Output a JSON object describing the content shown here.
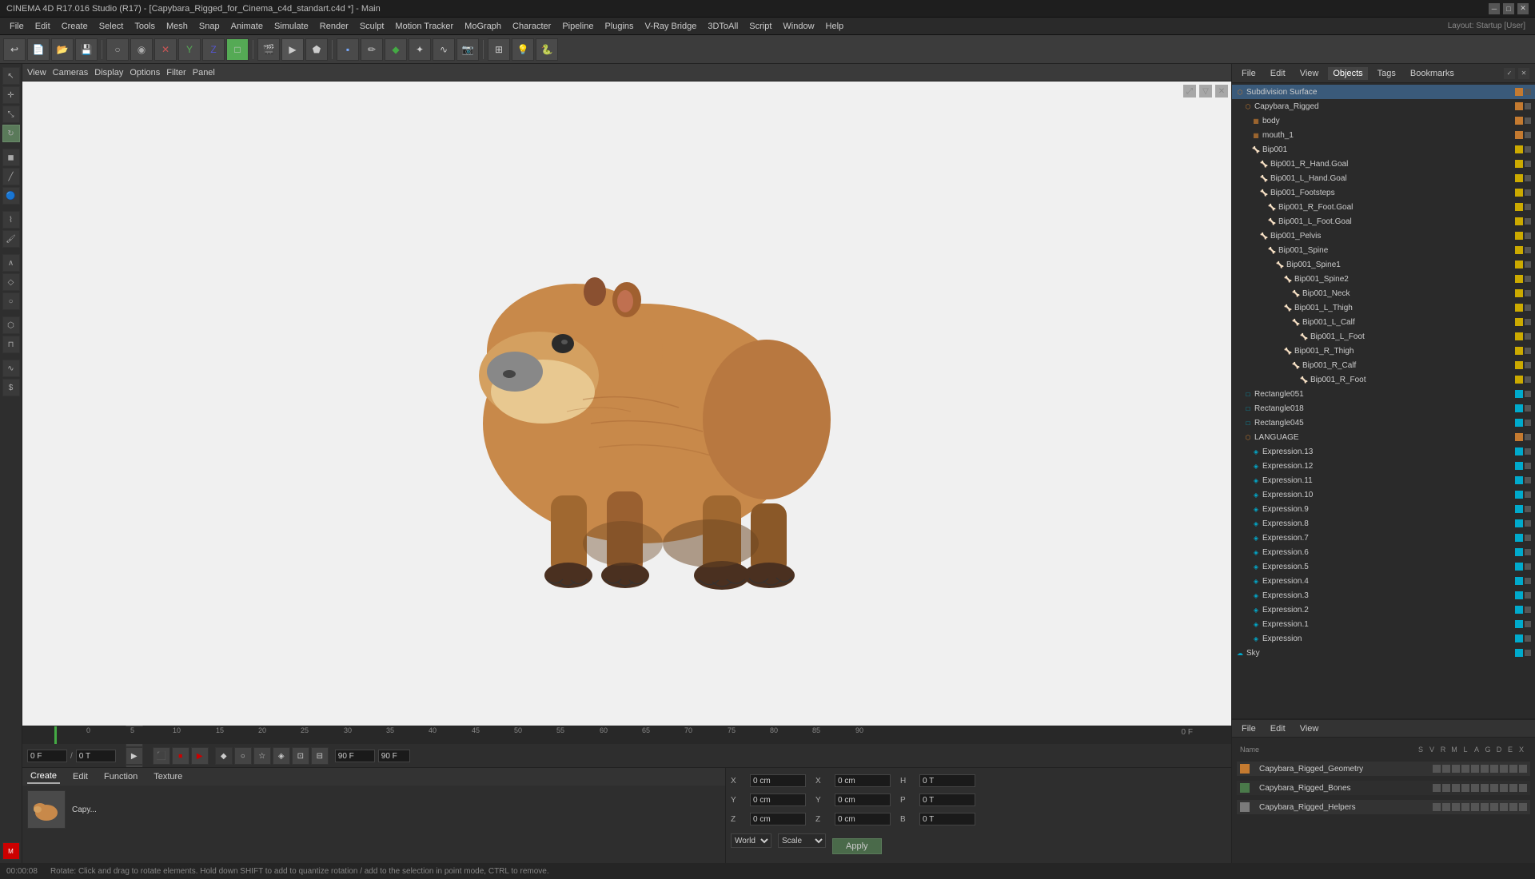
{
  "titlebar": {
    "title": "CINEMA 4D R17.016 Studio (R17) - [Capybara_Rigged_for_Cinema_c4d_standart.c4d *] - Main",
    "minimize": "─",
    "maximize": "□",
    "close": "✕"
  },
  "menus": {
    "items": [
      "File",
      "Edit",
      "Create",
      "Select",
      "Tools",
      "Mesh",
      "Snap",
      "Animate",
      "Simulate",
      "Render",
      "Sculpt",
      "Motion Tracker",
      "MoGraph",
      "Character",
      "Pipeline",
      "Plugins",
      "V-Ray Bridge",
      "3DToAll",
      "Script",
      "Window",
      "Help"
    ]
  },
  "layout": {
    "label": "Layout:",
    "value": "Startup [User]"
  },
  "viewport": {
    "tabs": [
      "View",
      "Cameras",
      "Display",
      "Options",
      "Filter",
      "Panel"
    ]
  },
  "objects": {
    "panel_tabs": [
      "File",
      "Edit",
      "View",
      "Objects",
      "Tags",
      "Bookmarks"
    ],
    "tree": [
      {
        "name": "Subdivision Surface",
        "indent": 0,
        "type": "group",
        "color": "orange",
        "expanded": true
      },
      {
        "name": "Capybara_Rigged",
        "indent": 1,
        "type": "group",
        "color": "orange",
        "expanded": true
      },
      {
        "name": "body",
        "indent": 2,
        "type": "mesh",
        "color": "orange",
        "expanded": false
      },
      {
        "name": "mouth_1",
        "indent": 2,
        "type": "mesh",
        "color": "orange",
        "expanded": false
      },
      {
        "name": "Bip001",
        "indent": 2,
        "type": "bone",
        "color": "yellow",
        "expanded": true
      },
      {
        "name": "Bip001_R_Hand.Goal",
        "indent": 3,
        "type": "bone",
        "color": "yellow"
      },
      {
        "name": "Bip001_L_Hand.Goal",
        "indent": 3,
        "type": "bone",
        "color": "yellow"
      },
      {
        "name": "Bip001_Footsteps",
        "indent": 3,
        "type": "bone",
        "color": "yellow",
        "expanded": true
      },
      {
        "name": "Bip001_R_Foot.Goal",
        "indent": 4,
        "type": "bone",
        "color": "yellow"
      },
      {
        "name": "Bip001_L_Foot.Goal",
        "indent": 4,
        "type": "bone",
        "color": "yellow"
      },
      {
        "name": "Bip001_Pelvis",
        "indent": 3,
        "type": "bone",
        "color": "yellow",
        "expanded": true
      },
      {
        "name": "Bip001_Spine",
        "indent": 4,
        "type": "bone",
        "color": "yellow",
        "expanded": true
      },
      {
        "name": "Bip001_Spine1",
        "indent": 5,
        "type": "bone",
        "color": "yellow",
        "expanded": true
      },
      {
        "name": "Bip001_Spine2",
        "indent": 6,
        "type": "bone",
        "color": "yellow",
        "expanded": true
      },
      {
        "name": "Bip001_Neck",
        "indent": 7,
        "type": "bone",
        "color": "yellow"
      },
      {
        "name": "Bip001_L_Thigh",
        "indent": 6,
        "type": "bone",
        "color": "yellow",
        "expanded": true
      },
      {
        "name": "Bip001_L_Calf",
        "indent": 7,
        "type": "bone",
        "color": "yellow",
        "expanded": true
      },
      {
        "name": "Bip001_L_Foot",
        "indent": 8,
        "type": "bone",
        "color": "yellow"
      },
      {
        "name": "Bip001_R_Thigh",
        "indent": 6,
        "type": "bone",
        "color": "yellow",
        "expanded": true
      },
      {
        "name": "Bip001_R_Calf",
        "indent": 7,
        "type": "bone",
        "color": "yellow",
        "expanded": true
      },
      {
        "name": "Bip001_R_Foot",
        "indent": 8,
        "type": "bone",
        "color": "yellow"
      },
      {
        "name": "Rectangle051",
        "indent": 1,
        "type": "rect",
        "color": "cyan"
      },
      {
        "name": "Rectangle018",
        "indent": 1,
        "type": "rect",
        "color": "cyan"
      },
      {
        "name": "Rectangle045",
        "indent": 1,
        "type": "rect",
        "color": "cyan"
      },
      {
        "name": "LANGUAGE",
        "indent": 1,
        "type": "group",
        "color": "orange",
        "expanded": true
      },
      {
        "name": "Expression.13",
        "indent": 2,
        "type": "expr",
        "color": "cyan"
      },
      {
        "name": "Expression.12",
        "indent": 2,
        "type": "expr",
        "color": "cyan"
      },
      {
        "name": "Expression.11",
        "indent": 2,
        "type": "expr",
        "color": "cyan"
      },
      {
        "name": "Expression.10",
        "indent": 2,
        "type": "expr",
        "color": "cyan"
      },
      {
        "name": "Expression.9",
        "indent": 2,
        "type": "expr",
        "color": "cyan"
      },
      {
        "name": "Expression.8",
        "indent": 2,
        "type": "expr",
        "color": "cyan"
      },
      {
        "name": "Expression.7",
        "indent": 2,
        "type": "expr",
        "color": "cyan"
      },
      {
        "name": "Expression.6",
        "indent": 2,
        "type": "expr",
        "color": "cyan"
      },
      {
        "name": "Expression.5",
        "indent": 2,
        "type": "expr",
        "color": "cyan"
      },
      {
        "name": "Expression.4",
        "indent": 2,
        "type": "expr",
        "color": "cyan"
      },
      {
        "name": "Expression.3",
        "indent": 2,
        "type": "expr",
        "color": "cyan"
      },
      {
        "name": "Expression.2",
        "indent": 2,
        "type": "expr",
        "color": "cyan"
      },
      {
        "name": "Expression.1",
        "indent": 2,
        "type": "expr",
        "color": "cyan"
      },
      {
        "name": "Expression",
        "indent": 2,
        "type": "expr",
        "color": "cyan"
      },
      {
        "name": "Sky",
        "indent": 0,
        "type": "sky",
        "color": "cyan"
      }
    ]
  },
  "timeline": {
    "current_frame": "0 F",
    "end_frame": "90 F",
    "ticks": [
      "0",
      "5",
      "10",
      "15",
      "20",
      "25",
      "30",
      "35",
      "40",
      "45",
      "50",
      "55",
      "60",
      "65",
      "70",
      "75",
      "80",
      "85",
      "90"
    ]
  },
  "bottom_panel": {
    "tabs": [
      "Create",
      "Edit",
      "Function",
      "Texture"
    ],
    "object_name": "Capy...",
    "coord_labels": [
      "X",
      "Y",
      "Z"
    ],
    "coord_values_pos": [
      "0 cm",
      "0 cm",
      "0 cm"
    ],
    "coord_values_rot": [
      "0 cm",
      "0 cm",
      "0 cm"
    ],
    "coord_extra": [
      "H",
      "P",
      "B"
    ],
    "coord_extra_vals": [
      "0 T",
      "0 T",
      "0 T"
    ],
    "space": "World",
    "mode": "Scale",
    "apply_label": "Apply"
  },
  "attr_panel": {
    "tabs": [
      "File",
      "Edit",
      "View"
    ],
    "objects_label": "Name",
    "objects_columns": [
      "S",
      "V",
      "R",
      "M",
      "L",
      "A",
      "G",
      "D",
      "E",
      "X"
    ],
    "objects": [
      {
        "name": "Capybara_Rigged_Geometry",
        "color": "#c47a30"
      },
      {
        "name": "Capybara_Rigged_Bones",
        "color": "#4a7a4a"
      },
      {
        "name": "Capybara_Rigged_Helpers",
        "color": "#7a7a7a"
      }
    ]
  },
  "status_bar": {
    "time": "00:00:08",
    "message": "Rotate: Click and drag to rotate elements. Hold down SHIFT to add to quantize rotation / add to the selection in point mode, CTRL to remove."
  }
}
